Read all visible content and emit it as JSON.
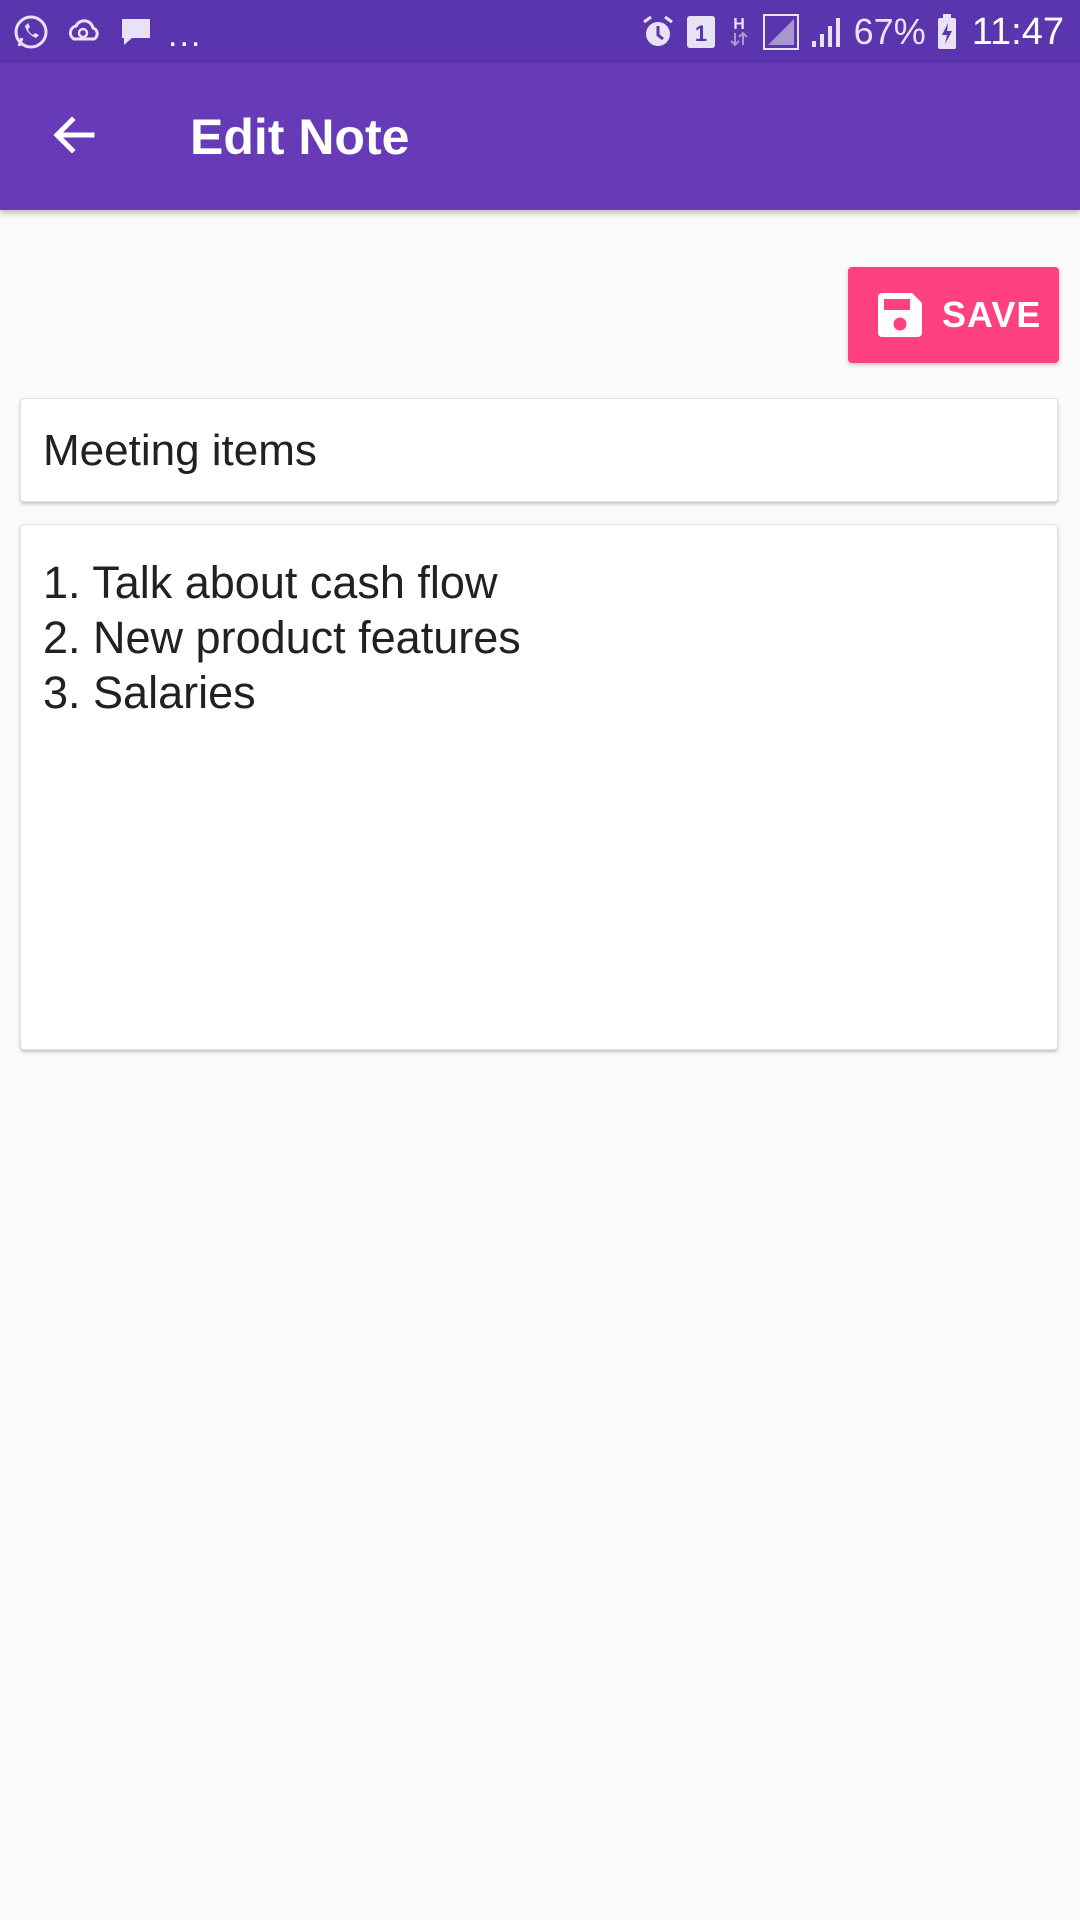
{
  "status_bar": {
    "icons_left": [
      "whatsapp-icon",
      "sync-cloud-icon",
      "message-icon"
    ],
    "more_notifications": "...",
    "icons_right": [
      "alarm-icon",
      "sim-1-icon",
      "h-data-icon",
      "signal-icon",
      "signal-icon",
      "battery-charging-icon"
    ],
    "battery": "67%",
    "time": "11:47"
  },
  "app_bar": {
    "title": "Edit Note",
    "back_icon": "arrow-back-icon",
    "background_color": "#673ab7"
  },
  "toolbar": {
    "save_label": "SAVE",
    "save_icon": "floppy-disk-icon",
    "accent_color": "#ff4081"
  },
  "note": {
    "title": "Meeting items",
    "body_lines": [
      "1. Talk about cash flow",
      "2. New product features",
      "3. Salaries"
    ]
  }
}
